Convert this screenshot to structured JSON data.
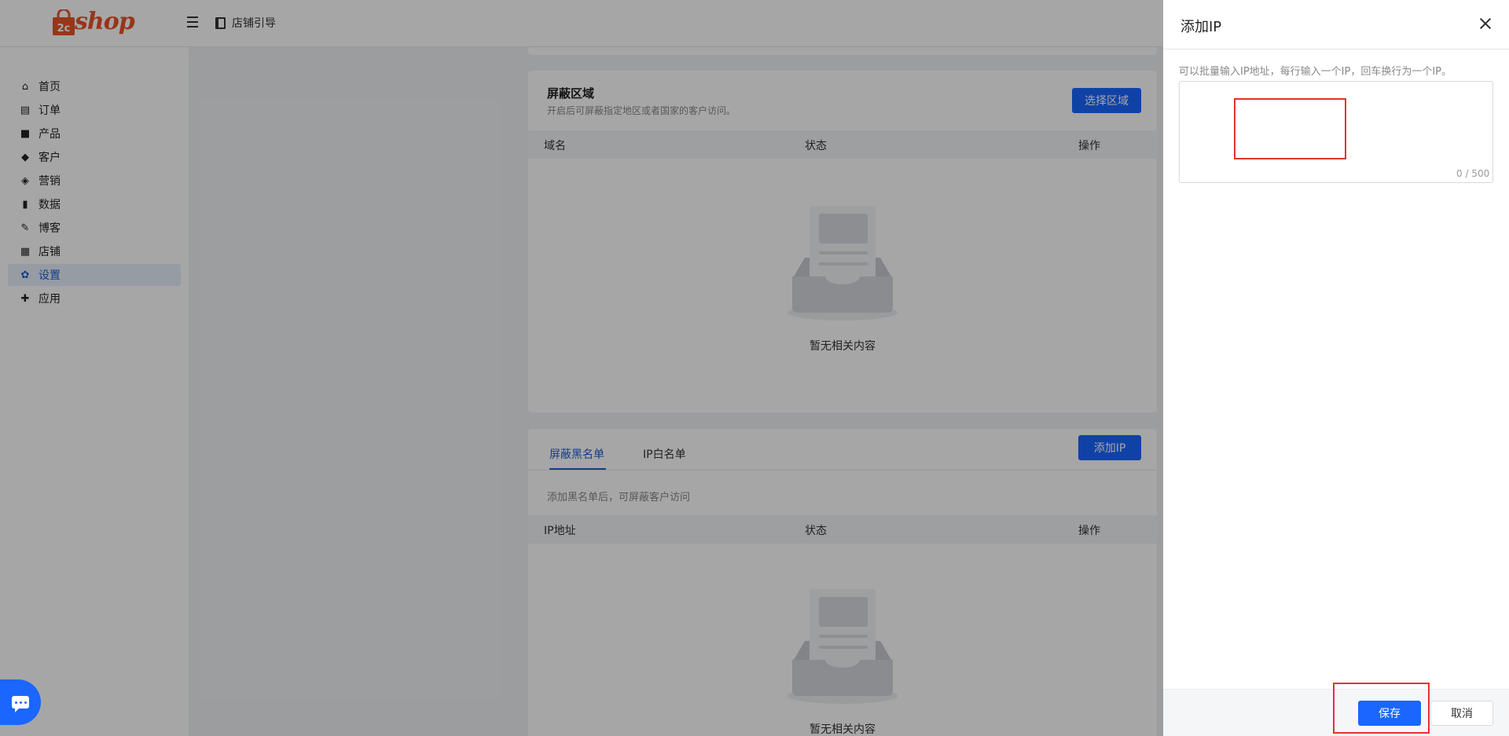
{
  "header": {
    "logo_text": "shop",
    "logo_prefix": "2c",
    "guide_label": "店铺引导"
  },
  "sidebar": {
    "items": [
      {
        "label": "首页",
        "icon": "home-icon"
      },
      {
        "label": "订单",
        "icon": "clipboard-icon"
      },
      {
        "label": "产品",
        "icon": "bag-icon"
      },
      {
        "label": "客户",
        "icon": "diamond-icon"
      },
      {
        "label": "营销",
        "icon": "tag-icon"
      },
      {
        "label": "数据",
        "icon": "bar-chart-icon"
      },
      {
        "label": "博客",
        "icon": "edit-icon"
      },
      {
        "label": "店铺",
        "icon": "store-icon"
      },
      {
        "label": "设置",
        "icon": "gear-icon",
        "active": true
      },
      {
        "label": "应用",
        "icon": "puzzle-icon"
      }
    ]
  },
  "region_card": {
    "title": "屏蔽区域",
    "subtitle": "开启后可屏蔽指定地区或者国家的客户访问。",
    "select_button": "选择区域",
    "columns": [
      "域名",
      "状态",
      "操作"
    ],
    "empty_text": "暂无相关内容"
  },
  "blacklist_card": {
    "tabs": [
      "屏蔽黑名单",
      "IP白名单"
    ],
    "add_button": "添加IP",
    "hint": "添加黑名单后，可屏蔽客户访问",
    "columns": [
      "IP地址",
      "状态",
      "操作"
    ],
    "empty_text": "暂无相关内容"
  },
  "drawer": {
    "title": "添加IP",
    "hint": "可以批量输入IP地址，每行输入一个IP，回车换行为一个IP。",
    "textarea_value": "",
    "counter": "0 / 500",
    "save_label": "保存",
    "cancel_label": "取消"
  },
  "colors": {
    "accent": "#1a66ff",
    "brand": "#e8542a",
    "highlight": "#e5322b"
  }
}
